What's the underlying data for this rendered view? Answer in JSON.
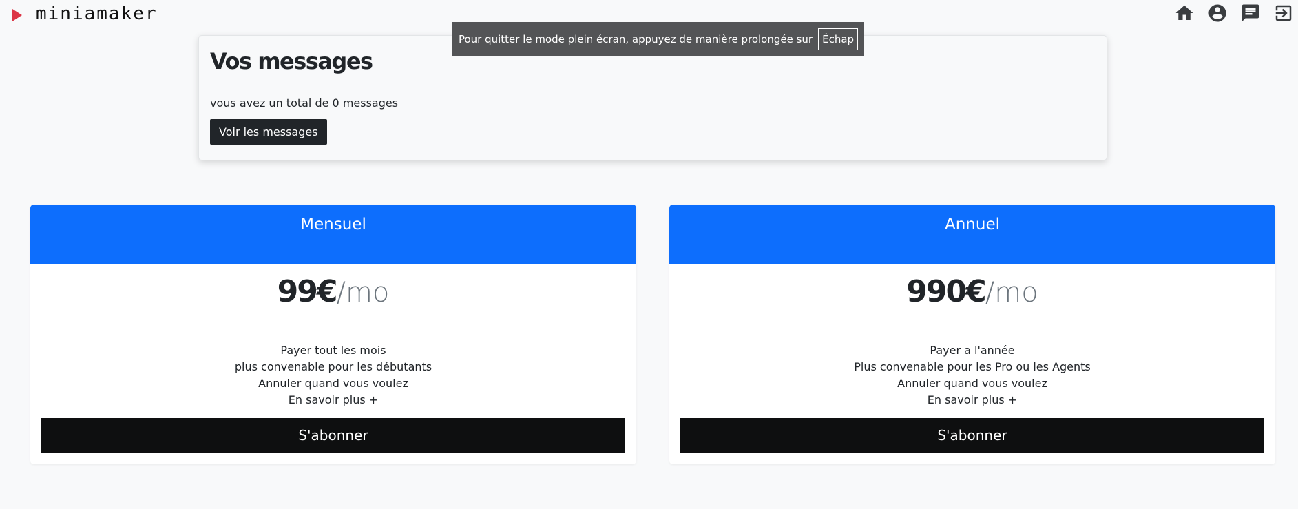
{
  "brand": {
    "name": "miniamaker",
    "logo_icon": "play-icon",
    "logo_color": "#dc3545"
  },
  "nav_icons": [
    "home-icon",
    "account-icon",
    "messages-icon",
    "logout-icon"
  ],
  "fullscreen_toast": {
    "text": "Pour quitter le mode plein écran, appuyez de manière prolongée sur",
    "key": "Échap"
  },
  "messages": {
    "title": "Vos messages",
    "count_text": "vous avez un total de 0 messages",
    "button": "Voir les messages"
  },
  "plans": [
    {
      "name": "Mensuel",
      "amount": "99€",
      "period": "/mo",
      "features": [
        "Payer tout les mois",
        "plus convenable pour les débutants",
        "Annuler quand vous voulez",
        "En savoir plus +"
      ],
      "cta": "S'abonner"
    },
    {
      "name": "Annuel",
      "amount": "990€",
      "period": "/mo",
      "features": [
        "Payer a l'année",
        "Plus convenable pour les Pro ou les Agents",
        "Annuler quand vous voulez",
        "En savoir plus +"
      ],
      "cta": "S'abonner"
    }
  ],
  "colors": {
    "accent": "#0d6efd",
    "dark": "#212529",
    "background": "#f8f9fa"
  }
}
